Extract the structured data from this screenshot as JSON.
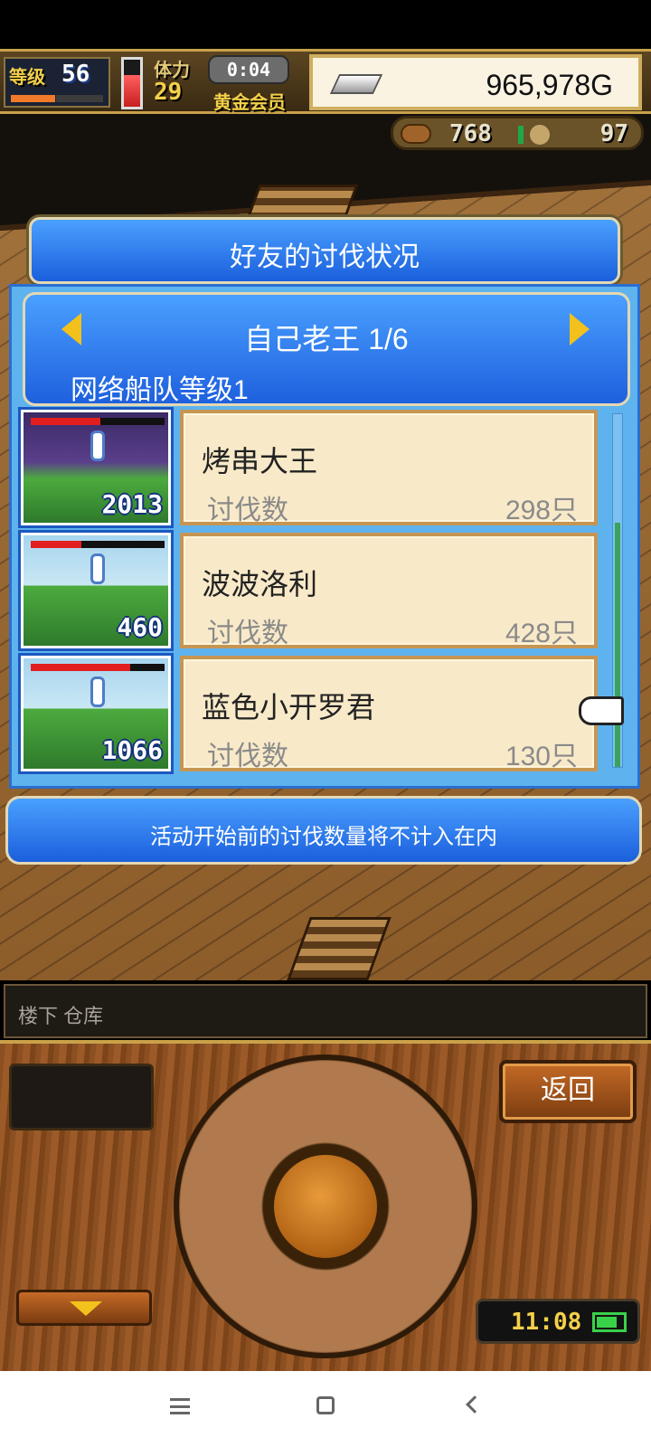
{
  "hud": {
    "level_label": "等级",
    "level_value": "56",
    "level_progress": 0.48,
    "stamina_label": "体力",
    "stamina_value": "29",
    "stamina_fill": 0.68,
    "timer": "0:04",
    "membership": "黄金会员",
    "gold": "965,978G"
  },
  "resources": {
    "meat_value": "768",
    "medal_value": "97"
  },
  "dialog": {
    "title": "好友的讨伐状况",
    "friend_name": "自己老王 1/6",
    "fleet_level": "网络船队等级1",
    "entries": [
      {
        "name": "烤串大王",
        "count_label": "讨伐数",
        "count": "298只",
        "enemy_id": "2013",
        "hp_fill": 0.52,
        "hp_color": "#e21e1e",
        "thumb_style": "dark"
      },
      {
        "name": "波波洛利",
        "count_label": "讨伐数",
        "count": "428只",
        "enemy_id": "460",
        "hp_fill": 0.38,
        "hp_color": "#e21e1e",
        "thumb_style": "light"
      },
      {
        "name": "蓝色小开罗君",
        "count_label": "讨伐数",
        "count": "130只",
        "enemy_id": "1066",
        "hp_fill": 0.74,
        "hp_color": "#e21e1e",
        "thumb_style": "light"
      }
    ],
    "notice": "活动开始前的讨伐数量将不计入在内"
  },
  "location": "楼下 仓库",
  "controls": {
    "back_label": "返回",
    "clock": "11:08",
    "battery_level": 0.8
  },
  "colors": {
    "panel_blue": "#1b5fdc",
    "card_bg": "#f8e9c8",
    "gold_text": "#f4d04a"
  }
}
